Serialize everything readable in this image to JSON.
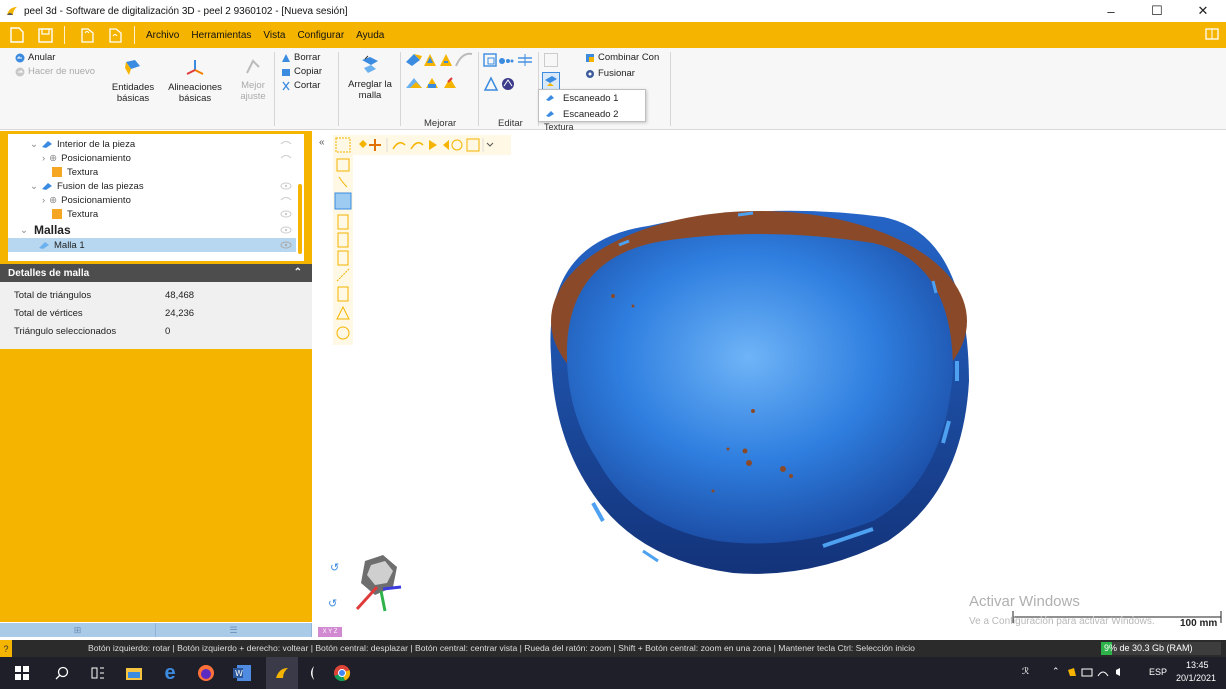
{
  "window": {
    "title": "peel 3d - Software de digitalización 3D - peel 2 9360102 - [Nueva sesión]",
    "controls": {
      "minimize": "–",
      "maximize": "☐",
      "close": "✕"
    }
  },
  "menu": {
    "items": [
      "Archivo",
      "Herramientas",
      "Vista",
      "Configurar",
      "Ayuda"
    ]
  },
  "ribbon": {
    "undo": "Anular",
    "redo": "Hacer de nuevo",
    "entities": "Entidades básicas",
    "alignments": "Alineaciones básicas",
    "best_fit": "Mejor ajuste",
    "delete": "Borrar",
    "copy": "Copiar",
    "cut": "Cortar",
    "fix_mesh": "Arreglar la malla",
    "group_improve": "Mejorar",
    "group_edit": "Editar",
    "group_texture": "Textura",
    "combine_with": "Combinar Con",
    "merge": "Fusionar",
    "dropdown": [
      "Escaneado 1",
      "Escaneado 2"
    ]
  },
  "tree": {
    "rows": [
      "Interior de la pieza",
      "Posicionamiento",
      "Textura",
      "Fusion de las piezas",
      "Posicionamiento",
      "Textura",
      "Mallas",
      "Malla 1"
    ]
  },
  "details": {
    "header": "Detalles de malla",
    "rows": [
      {
        "label": "Total de triángulos",
        "value": "48,468"
      },
      {
        "label": "Total de vértices",
        "value": "24,236"
      },
      {
        "label": "Triángulo seleccionados",
        "value": "0"
      }
    ]
  },
  "viewport": {
    "watermark_title": "Activar Windows",
    "watermark_sub": "Ve a Configuración para activar Windows.",
    "scale": "100 mm",
    "axis_tag": "X Y Z"
  },
  "status": {
    "help": "?",
    "text": "Botón izquierdo: rotar | Botón izquierdo + derecho: voltear | Botón central: desplazar | Botón central: centrar vista | Rueda del ratón: zoom | Shift + Botón central: zoom en una zona | Mantener tecla Ctrl: Selección inicio",
    "ram": "9% de 30.3 Gb (RAM)",
    "ram_fraction": 0.09
  },
  "taskbar": {
    "lang": "ESP",
    "time": "13:45",
    "date": "20/1/2021"
  },
  "colors": {
    "accent": "#f5b400",
    "mesh_blue": "#2f7fe0",
    "mesh_rust": "#8a4a2a"
  }
}
